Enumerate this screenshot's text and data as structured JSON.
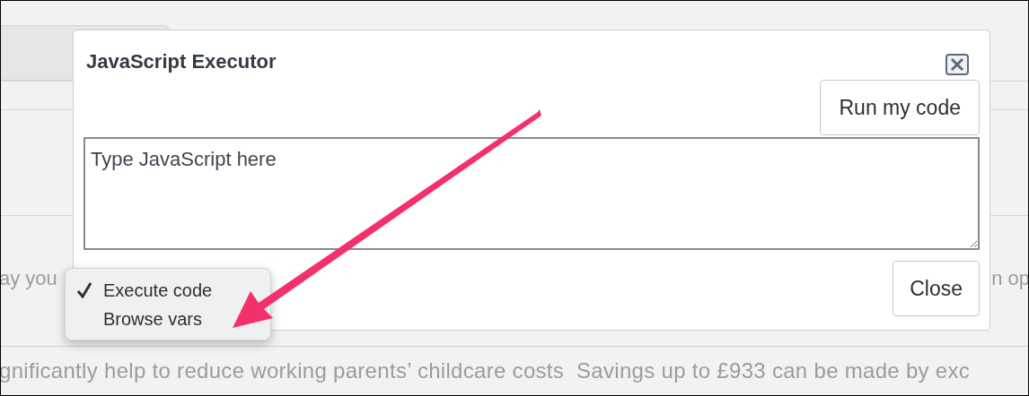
{
  "background": {
    "row_text_left": "ay you",
    "row_text_right": "n op",
    "footer_text": "gnificantly help to reduce working parents’ childcare costs  Savings up to £933 can be made by exc"
  },
  "dialog": {
    "title": "JavaScript Executor",
    "run_button": "Run my code",
    "code_field": {
      "placeholder": "Type JavaScript here"
    },
    "close_button": "Close"
  },
  "menu": {
    "items": [
      {
        "label": "Execute code",
        "checked": true
      },
      {
        "label": "Browse vars",
        "checked": false
      }
    ]
  },
  "annotation": {
    "kind": "arrow"
  }
}
